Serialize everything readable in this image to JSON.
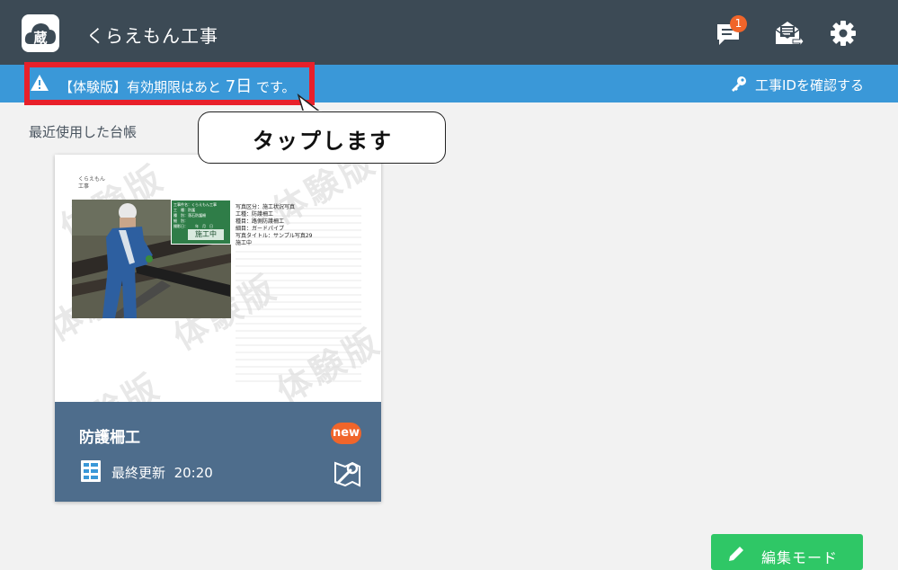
{
  "app": {
    "logo_text": "蔵",
    "title": "くらえもん工事"
  },
  "header": {
    "notification_count": "1",
    "icons": [
      "chat-icon",
      "mail-share-icon",
      "gear-icon"
    ]
  },
  "banner": {
    "prefix": "【体験版】有効期限はあと ",
    "days": "7日",
    "suffix": " です。",
    "confirm_id": "工事IDを確認する",
    "highlight_color": "#e8202a"
  },
  "callout": {
    "text": "タップします"
  },
  "recent": {
    "label": "最近使用した台帳"
  },
  "card": {
    "watermark": "体験版",
    "preview": {
      "company": "くらえもん",
      "sub": "工事",
      "board_lines": [
        "工事件名：くらえもん工事",
        "工　種：防護",
        "種　別：落石防護柵",
        "細　別：",
        "撮影日：　　年　月　日"
      ],
      "board_main": "施工中",
      "info_lines": [
        "写真区分：施工状況写真",
        "工種：防護柵工",
        "種目：路側防護柵工",
        "細目：ガードパイプ",
        "写真タイトル：サンプル写真29",
        "施工中"
      ]
    },
    "title": "防護柵工",
    "new_label": "new",
    "last_updated_label": "最終更新",
    "last_updated_time": "20:20"
  },
  "edit_button": {
    "label": "編集モード"
  },
  "colors": {
    "topbar": "#3c4a55",
    "banner": "#3a98d8",
    "card_footer": "#4e6d8c",
    "badge": "#f0652a",
    "edit_button": "#2fc766"
  }
}
